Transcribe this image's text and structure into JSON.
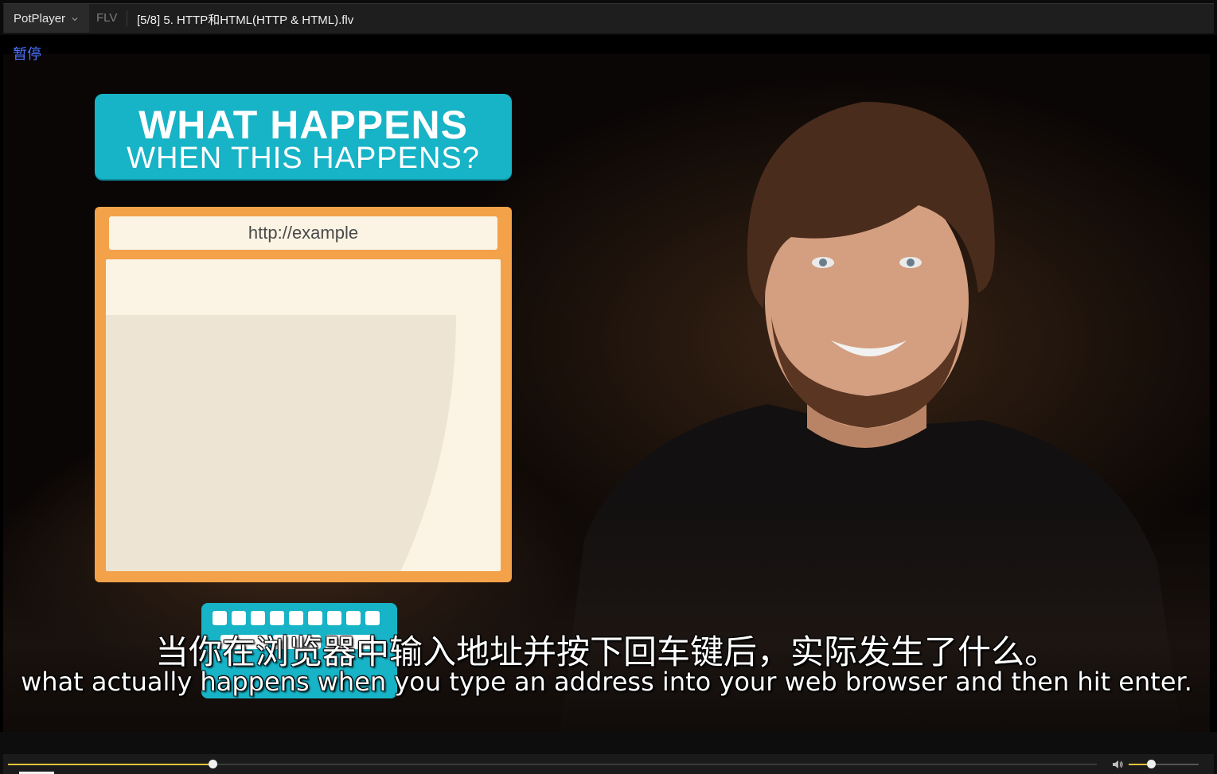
{
  "app": {
    "name": "PotPlayer",
    "format": "FLV",
    "file_title": "[5/8] 5. HTTP和HTML(HTTP & HTML).flv"
  },
  "osd": {
    "status": "暂停"
  },
  "video": {
    "header_line1": "WHAT HAPPENS",
    "header_line2": "WHEN THIS HAPPENS?",
    "url_text": "http://example",
    "accent_teal": "#17b3c6",
    "accent_orange": "#f3a24a"
  },
  "subtitles": {
    "chinese": "当你在浏览器中输入地址并按下回车键后，实际发生了什么。",
    "english": "what actually happens when you type an address into your web browser and then hit enter."
  },
  "controls": {
    "seek_progress": 0.188,
    "volume_level": 0.32,
    "accent_color": "#e9c23a",
    "icons": [
      "chevron-down-icon",
      "volume-icon"
    ]
  }
}
